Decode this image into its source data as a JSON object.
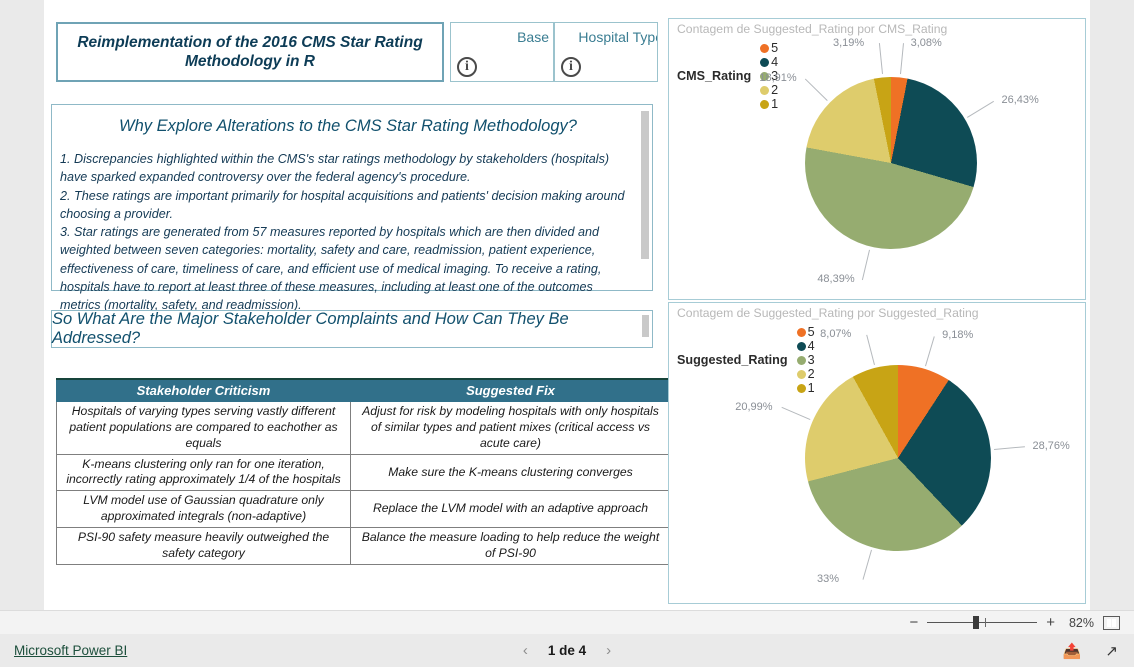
{
  "report": {
    "title_card": "Reimplementation of the 2016 CMS Star Rating Methodology in R",
    "slicers": [
      {
        "label": "Base",
        "icon": "info-icon"
      },
      {
        "label": "Hospital Type",
        "icon": "info-icon"
      }
    ],
    "text_panel": {
      "heading": "Why Explore Alterations to the CMS Star Rating Methodology?",
      "body": "1. Discrepancies highlighted within the CMS's star ratings methodology by stakeholders (hospitals) have sparked expanded controversy over the federal agency's procedure.\n2. These ratings are important primarily for hospital acquisitions and patients' decision making around choosing a provider.\n3. Star ratings are generated from 57 measures reported by hospitals which are then divided and weighted between seven categories: mortality, safety and care, readmission, patient experience, effectiveness of care, timeliness of care, and efficient use of medical imaging. To receive a rating, hospitals have to report at least three of these measures, including at least one of the outcomes metrics (mortality, safety, and readmission)."
    },
    "question_bar": "So What Are the Major Stakeholder Complaints and How Can They Be Addressed?",
    "table": {
      "headers": [
        "Stakeholder Criticism",
        "Suggested Fix"
      ],
      "rows": [
        [
          "Hospitals of varying types serving vastly different patient populations are compared to eachother as equals",
          "Adjust for risk by modeling hospitals with only hospitals of similar types and patient mixes (critical access vs acute care)"
        ],
        [
          "K-means clustering only ran for one iteration, incorrectly rating approximately 1/4 of the hospitals",
          "Make sure the K-means clustering converges"
        ],
        [
          "LVM model use of Gaussian quadrature only approximated integrals (non-adaptive)",
          "Replace the LVM model with an adaptive approach"
        ],
        [
          "PSI-90 safety measure heavily outweighed the safety category",
          "Balance the measure loading to help reduce the weight of PSI-90"
        ]
      ]
    }
  },
  "chart_data": [
    {
      "type": "pie",
      "title": "Contagem de Suggested_Rating por CMS_Rating",
      "legend_title": "CMS_Rating",
      "legend_position": "top",
      "categories": [
        "5",
        "4",
        "3",
        "2",
        "1"
      ],
      "values": [
        3.08,
        26.43,
        48.39,
        18.91,
        3.19
      ],
      "labels": [
        "3,08%",
        "26,43%",
        "48,39%",
        "18,91%",
        "3,19%"
      ],
      "colors": [
        "#EF7125",
        "#0E4B55",
        "#96AC70",
        "#DECC6C",
        "#C8A415"
      ]
    },
    {
      "type": "pie",
      "title": "Contagem de Suggested_Rating por Suggested_Rating",
      "legend_title": "Suggested_Rating",
      "legend_position": "top",
      "categories": [
        "5",
        "4",
        "3",
        "2",
        "1"
      ],
      "values": [
        9.18,
        28.76,
        33.0,
        20.99,
        8.07
      ],
      "labels": [
        "9,18%",
        "28,76%",
        "33%",
        "20,99%",
        "8,07%"
      ],
      "colors": [
        "#EF7125",
        "#0E4B55",
        "#96AC70",
        "#DECC6C",
        "#C8A415"
      ]
    }
  ],
  "zoom_bar": {
    "minus": "−",
    "plus": "+",
    "percent": "82%",
    "fit_icon": "fit-to-page-icon"
  },
  "footer": {
    "brand": "Microsoft Power BI",
    "prev_icon": "chevron-left-icon",
    "page_indicator": "1 de 4",
    "next_icon": "chevron-right-icon",
    "share_icon": "share-icon",
    "fullscreen_icon": "fullscreen-icon"
  }
}
